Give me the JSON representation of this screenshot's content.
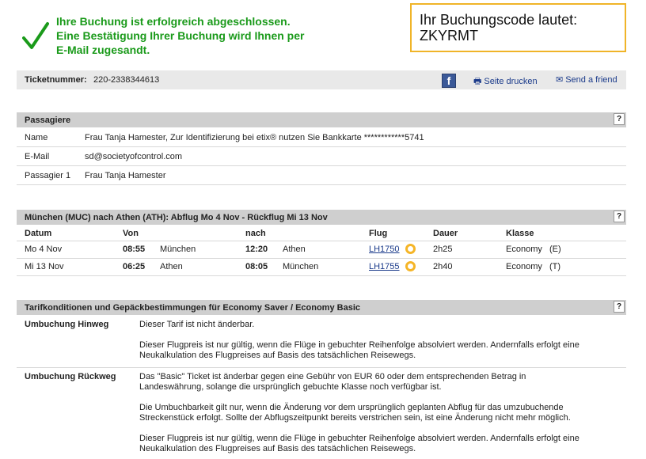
{
  "confirmation": {
    "line1": "Ihre Buchung ist erfolgreich abgeschlossen.",
    "line2": "Eine Bestätigung Ihrer Buchung wird Ihnen per",
    "line3": "E-Mail zugesandt."
  },
  "booking_code": {
    "label": "Ihr Buchungscode lautet:",
    "code": "ZKYRMT"
  },
  "ticket": {
    "label": "Ticketnummer:",
    "number": "220-2338344613",
    "facebook_icon": "f",
    "print_label": "Seite drucken",
    "send_label": "Send a friend"
  },
  "help_label": "?",
  "passengers": {
    "title": "Passagiere",
    "rows": [
      {
        "key": "Name",
        "value": "Frau  Tanja Hamester, Zur Identifizierung bei etix® nutzen Sie Bankkarte ************5741"
      },
      {
        "key": "E-Mail",
        "value": "sd@societyofcontrol.com"
      },
      {
        "key": "Passagier 1",
        "value": "Frau Tanja Hamester"
      }
    ]
  },
  "flights": {
    "title": "München (MUC)  nach  Athen (ATH):  Abflug  Mo 4 Nov -  Rückflug  Mi 13 Nov",
    "headers": {
      "datum": "Datum",
      "von": "Von",
      "nach": "nach",
      "flug": "Flug",
      "dauer": "Dauer",
      "klasse": "Klasse"
    },
    "rows": [
      {
        "date": "Mo 4 Nov",
        "dep_time": "08:55",
        "dep_city": "München",
        "arr_time": "12:20",
        "arr_city": "Athen",
        "flight": "LH1750",
        "duration": "2h25",
        "class": "Economy",
        "class_code": "(E)"
      },
      {
        "date": "Mi 13 Nov",
        "dep_time": "06:25",
        "dep_city": "Athen",
        "arr_time": "08:05",
        "arr_city": "München",
        "flight": "LH1755",
        "duration": "2h40",
        "class": "Economy",
        "class_code": "(T)"
      }
    ]
  },
  "tariff": {
    "title": "Tarifkonditionen und Gepäckbestimmungen für  Economy Saver / Economy Basic",
    "hinweg_label": "Umbuchung Hinweg",
    "hinweg_p1": "Dieser Tarif ist nicht änderbar.",
    "hinweg_p2a": "Dieser Flugpreis ist nur gültig, wenn die Flüge in gebuchter Reihenfolge absolviert werden. Andernfalls erfolgt eine",
    "hinweg_p2b": "Neukalkulation des Flugpreises auf Basis des tatsächlichen Reisewegs.",
    "rueckweg_label": "Umbuchung Rückweg",
    "rueckweg_p1a": "Das \"Basic\" Ticket ist änderbar gegen eine Gebühr von EUR 60 oder dem entsprechenden Betrag in",
    "rueckweg_p1b": "Landeswährung, solange die ursprünglich gebuchte Klasse noch verfügbar ist.",
    "rueckweg_p2a": "Die Umbuchbarkeit gilt nur, wenn die Änderung vor dem ursprünglich geplanten Abflug für das umzubuchende",
    "rueckweg_p2b": "Streckenstück erfolgt. Sollte der Abflugszeitpunkt bereits verstrichen sein, ist eine Änderung nicht mehr möglich.",
    "rueckweg_p3a": "Dieser Flugpreis ist nur gültig, wenn die Flüge in gebuchter Reihenfolge absolviert werden. Andernfalls erfolgt eine",
    "rueckweg_p3b": "Neukalkulation des Flugpreises auf Basis des tatsächlichen Reisewegs."
  }
}
